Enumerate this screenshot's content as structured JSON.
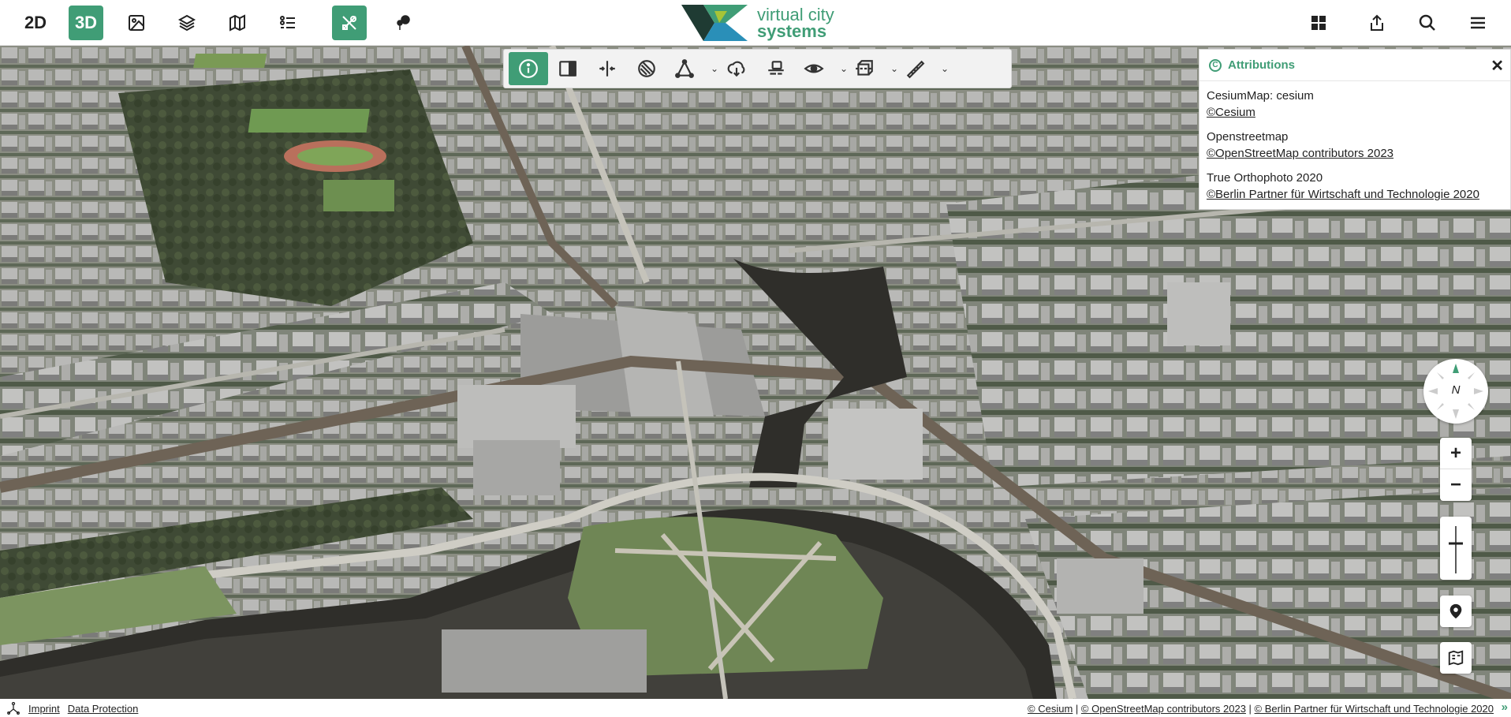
{
  "navbar": {
    "btn_2d": "2D",
    "btn_3d": "3D",
    "logo_line1": "virtual city",
    "logo_line2": "systems",
    "icons": [
      "image-icon",
      "layers-icon",
      "legend-icon",
      "list-icon",
      "tools-icon",
      "tree-pin-icon",
      "grid-icon",
      "share-icon",
      "search-icon",
      "menu-icon"
    ],
    "accent_color": "#409D76"
  },
  "toolbar": {
    "tools": [
      "info-tool",
      "split-view-tool",
      "compare-tool",
      "shadow-tool",
      "draw-tool",
      "export-tool",
      "flight-tool",
      "viewshed-tool",
      "clipping-tool",
      "measure-2d-tool"
    ]
  },
  "attributions": {
    "title": "Attributions",
    "entries": [
      {
        "name": "CesiumMap: cesium",
        "link": "©Cesium"
      },
      {
        "name": "Openstreetmap",
        "link": "©OpenStreetMap contributors 2023"
      },
      {
        "name": "True Orthophoto 2020",
        "link": "©Berlin Partner für Wirtschaft und Technologie 2020"
      }
    ]
  },
  "map_controls": {
    "compass_label": "N",
    "zoom_in": "+",
    "zoom_out": "−"
  },
  "footer": {
    "imprint": "Imprint",
    "data_protection": "Data Protection",
    "credit_cesium": "© Cesium",
    "credit_osm": "© OpenStreetMap contributors 2023",
    "credit_berlin": "© Berlin Partner für Wirtschaft und Technologie 2020",
    "separator": " | ",
    "more": "»"
  }
}
